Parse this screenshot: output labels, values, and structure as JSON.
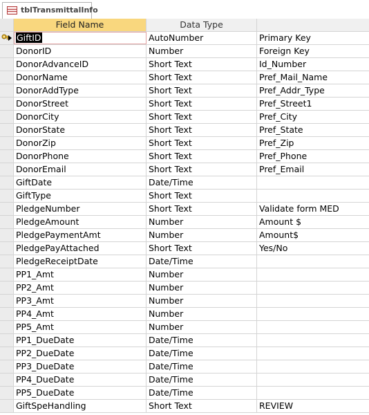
{
  "tab": {
    "label": "tblTransmittalInfo"
  },
  "columns": {
    "name": "Field Name",
    "type": "Data Type",
    "description": ""
  },
  "rows": [
    {
      "name": "GiftID",
      "type": "AutoNumber",
      "description": "Primary Key"
    },
    {
      "name": "DonorID",
      "type": "Number",
      "description": "Foreign Key"
    },
    {
      "name": "DonorAdvanceID",
      "type": "Short Text",
      "description": "Id_Number"
    },
    {
      "name": "DonorName",
      "type": "Short Text",
      "description": "Pref_Mail_Name"
    },
    {
      "name": "DonorAddType",
      "type": "Short Text",
      "description": "Pref_Addr_Type"
    },
    {
      "name": "DonorStreet",
      "type": "Short Text",
      "description": "Pref_Street1"
    },
    {
      "name": "DonorCity",
      "type": "Short Text",
      "description": "Pref_City"
    },
    {
      "name": "DonorState",
      "type": "Short Text",
      "description": "Pref_State"
    },
    {
      "name": "DonorZip",
      "type": "Short Text",
      "description": "Pref_Zip"
    },
    {
      "name": "DonorPhone",
      "type": "Short Text",
      "description": "Pref_Phone"
    },
    {
      "name": "DonorEmail",
      "type": "Short Text",
      "description": "Pref_Email"
    },
    {
      "name": "GiftDate",
      "type": "Date/Time",
      "description": ""
    },
    {
      "name": "GiftType",
      "type": "Short Text",
      "description": ""
    },
    {
      "name": "PledgeNumber",
      "type": "Short Text",
      "description": "Validate form MED"
    },
    {
      "name": "PledgeAmount",
      "type": "Number",
      "description": "Amount $"
    },
    {
      "name": "PledgePaymentAmt",
      "type": "Number",
      "description": "Amount$"
    },
    {
      "name": "PledgePayAttached",
      "type": "Short Text",
      "description": "Yes/No"
    },
    {
      "name": "PledgeReceiptDate",
      "type": "Date/Time",
      "description": ""
    },
    {
      "name": "PP1_Amt",
      "type": "Number",
      "description": ""
    },
    {
      "name": "PP2_Amt",
      "type": "Number",
      "description": ""
    },
    {
      "name": "PP3_Amt",
      "type": "Number",
      "description": ""
    },
    {
      "name": "PP4_Amt",
      "type": "Number",
      "description": ""
    },
    {
      "name": "PP5_Amt",
      "type": "Number",
      "description": ""
    },
    {
      "name": "PP1_DueDate",
      "type": "Date/Time",
      "description": ""
    },
    {
      "name": "PP2_DueDate",
      "type": "Date/Time",
      "description": ""
    },
    {
      "name": "PP3_DueDate",
      "type": "Date/Time",
      "description": ""
    },
    {
      "name": "PP4_DueDate",
      "type": "Date/Time",
      "description": ""
    },
    {
      "name": "PP5_DueDate",
      "type": "Date/Time",
      "description": ""
    },
    {
      "name": "GiftSpeHandling",
      "type": "Short Text",
      "description": "REVIEW"
    }
  ]
}
